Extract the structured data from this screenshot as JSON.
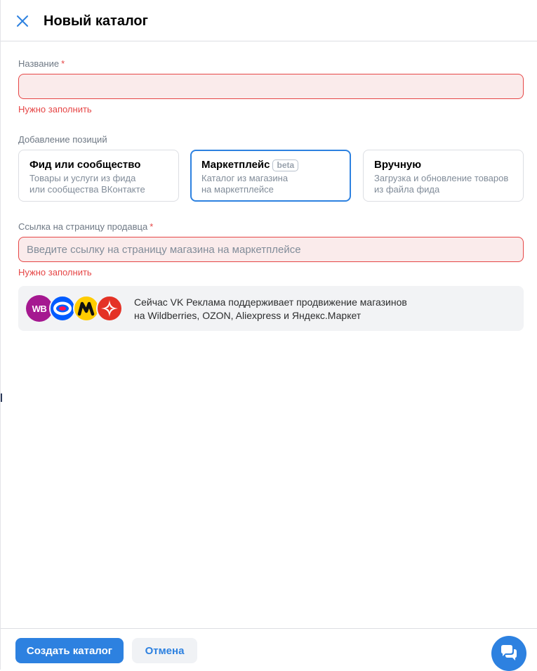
{
  "header": {
    "title": "Новый каталог",
    "close_icon": "close-icon"
  },
  "name_field": {
    "label": "Название",
    "required_mark": "*",
    "value": "",
    "placeholder": "",
    "error": "Нужно заполнить"
  },
  "positions": {
    "label": "Добавление позиций",
    "options": [
      {
        "title": "Фид или сообщество",
        "desc_line1": "Товары и услуги из фида",
        "desc_line2": "или сообщества ВКонтакте",
        "selected": false
      },
      {
        "title": "Маркетплейс",
        "badge": "beta",
        "desc_line1": "Каталог из магазина",
        "desc_line2": "на маркетплейсе",
        "selected": true
      },
      {
        "title": "Вручную",
        "desc_line1": "Загрузка и обновление товаров",
        "desc_line2": "из файла фида",
        "selected": false
      }
    ]
  },
  "seller_field": {
    "label": "Ссылка на страницу продавца",
    "required_mark": "*",
    "value": "",
    "placeholder": "Введите ссылку на страницу магазина на маркетплейсе",
    "error": "Нужно заполнить"
  },
  "info": {
    "line1": "Сейчас VK Реклама поддерживает продвижение магазинов",
    "line2": "на Wildberries, OZON, Aliexpress и Яндекс.Маркет",
    "logos": [
      {
        "name": "wildberries-logo",
        "text": "WB",
        "color": "#a51890"
      },
      {
        "name": "ozon-logo",
        "color": "#005bff"
      },
      {
        "name": "yandex-market-logo",
        "color": "#ffcc00"
      },
      {
        "name": "aliexpress-logo",
        "color": "#e43226"
      }
    ]
  },
  "footer": {
    "create_label": "Создать каталог",
    "cancel_label": "Отмена"
  },
  "chat": {
    "icon": "chat-icon"
  },
  "colors": {
    "accent": "#2d81e0",
    "error": "#e64646",
    "error_bg": "#faebeb"
  }
}
